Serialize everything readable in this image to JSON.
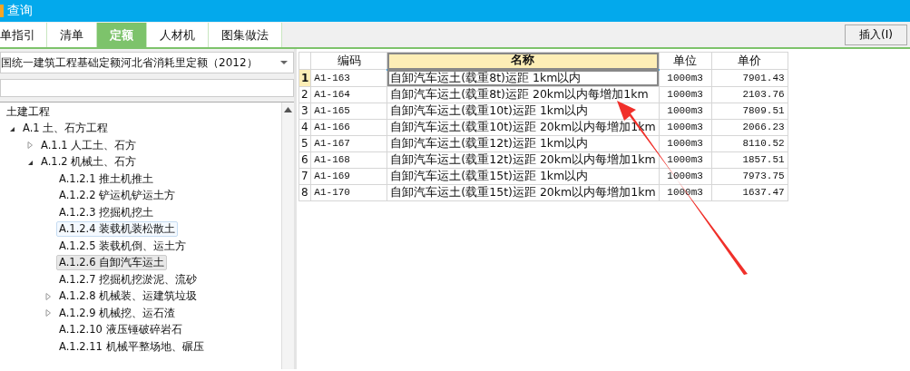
{
  "window": {
    "title": "查询"
  },
  "tabs": [
    {
      "label": "单指引",
      "selected": false
    },
    {
      "label": "清单",
      "selected": false
    },
    {
      "label": "定额",
      "selected": true
    },
    {
      "label": "人材机",
      "selected": false
    },
    {
      "label": "图集做法",
      "selected": false
    }
  ],
  "insert_button": "插入(I)",
  "library_dropdown": {
    "value": "国统一建筑工程基础定额河北省消耗里定额（2012）"
  },
  "tree": [
    {
      "label": "土建工程",
      "selected": false,
      "hovered": false,
      "children": [
        {
          "label": "A.1 土、石方工程",
          "expanded": true,
          "selected": false,
          "hovered": false,
          "children": [
            {
              "label": "A.1.1 人工土、石方",
              "expanded": false,
              "selected": false,
              "hovered": false
            },
            {
              "label": "A.1.2 机械土、石方",
              "expanded": true,
              "selected": false,
              "hovered": false,
              "children": [
                {
                  "label": "A.1.2.1 推土机推土",
                  "selected": false,
                  "hovered": false
                },
                {
                  "label": "A.1.2.2 铲运机铲运土方",
                  "selected": false,
                  "hovered": false
                },
                {
                  "label": "A.1.2.3 挖掘机挖土",
                  "selected": false,
                  "hovered": false
                },
                {
                  "label": "A.1.2.4 装载机装松散土",
                  "selected": false,
                  "hovered": true
                },
                {
                  "label": "A.1.2.5 装载机倒、运土方",
                  "selected": false,
                  "hovered": false
                },
                {
                  "label": "A.1.2.6 自卸汽车运土",
                  "selected": true,
                  "hovered": false
                },
                {
                  "label": "A.1.2.7 挖掘机挖淤泥、流砂",
                  "selected": false,
                  "hovered": false
                },
                {
                  "label": "A.1.2.8 机械装、运建筑垃圾",
                  "expanded": false,
                  "selected": false,
                  "hovered": false
                },
                {
                  "label": "A.1.2.9 机械挖、运石渣",
                  "expanded": false,
                  "selected": false,
                  "hovered": false
                },
                {
                  "label": "A.1.2.10 液压锤破碎岩石",
                  "selected": false,
                  "hovered": false
                },
                {
                  "label": "A.1.2.11 机械平整场地、碾压",
                  "selected": false,
                  "hovered": false
                }
              ]
            }
          ]
        }
      ]
    }
  ],
  "table": {
    "columns": [
      {
        "label": "编码",
        "selected": false
      },
      {
        "label": "名称",
        "selected": true
      },
      {
        "label": "单位",
        "selected": false
      },
      {
        "label": "单价",
        "selected": false
      }
    ],
    "rows": [
      {
        "index": "1",
        "code": "A1-163",
        "name": "自卸汽车运土(载重8t)运距 1km以内",
        "unit": "1000m3",
        "price": "7901.43",
        "selected": true
      },
      {
        "index": "2",
        "code": "A1-164",
        "name": "自卸汽车运土(载重8t)运距 20km以内每增加1km",
        "unit": "1000m3",
        "price": "2103.76",
        "selected": false
      },
      {
        "index": "3",
        "code": "A1-165",
        "name": "自卸汽车运土(载重10t)运距 1km以内",
        "unit": "1000m3",
        "price": "7809.51",
        "selected": false
      },
      {
        "index": "4",
        "code": "A1-166",
        "name": "自卸汽车运土(载重10t)运距 20km以内每增加1km",
        "unit": "1000m3",
        "price": "2066.23",
        "selected": false
      },
      {
        "index": "5",
        "code": "A1-167",
        "name": "自卸汽车运土(载重12t)运距 1km以内",
        "unit": "1000m3",
        "price": "8110.52",
        "selected": false
      },
      {
        "index": "6",
        "code": "A1-168",
        "name": "自卸汽车运土(载重12t)运距 20km以内每增加1km",
        "unit": "1000m3",
        "price": "1857.51",
        "selected": false
      },
      {
        "index": "7",
        "code": "A1-169",
        "name": "自卸汽车运土(载重15t)运距 1km以内",
        "unit": "1000m3",
        "price": "7973.75",
        "selected": false
      },
      {
        "index": "8",
        "code": "A1-170",
        "name": "自卸汽车运土(载重15t)运距 20km以内每增加1km",
        "unit": "1000m3",
        "price": "1637.47",
        "selected": false
      }
    ]
  }
}
